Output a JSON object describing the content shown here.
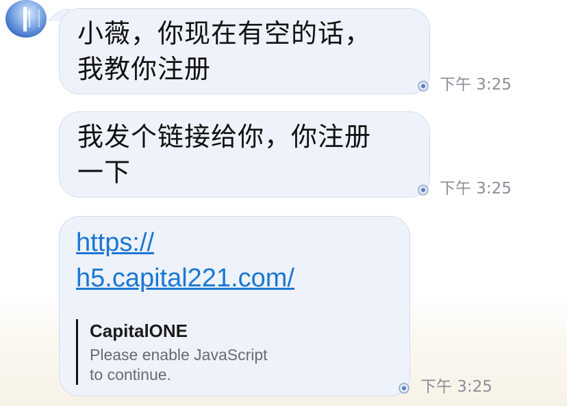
{
  "contact": {
    "avatar_icon": "avatar-icon"
  },
  "messages": [
    {
      "lines": [
        "小薇，你现在有空的话，",
        "我教你注册"
      ],
      "time": "下午 3:25"
    },
    {
      "lines": [
        "我发个链接给你，你注册",
        "一下"
      ],
      "time": "下午 3:25"
    },
    {
      "link_lines": [
        " https://",
        "h5.capital221.com/"
      ],
      "preview": {
        "title": "CapitalONE",
        "description_lines": [
          "Please enable JavaScript",
          "to continue."
        ]
      },
      "time": "下午 3:25"
    }
  ],
  "colors": {
    "bubble": "#eef2fb",
    "bubble_border": "#d3dceb",
    "link": "#1a76d2",
    "time": "#8a8f99"
  }
}
